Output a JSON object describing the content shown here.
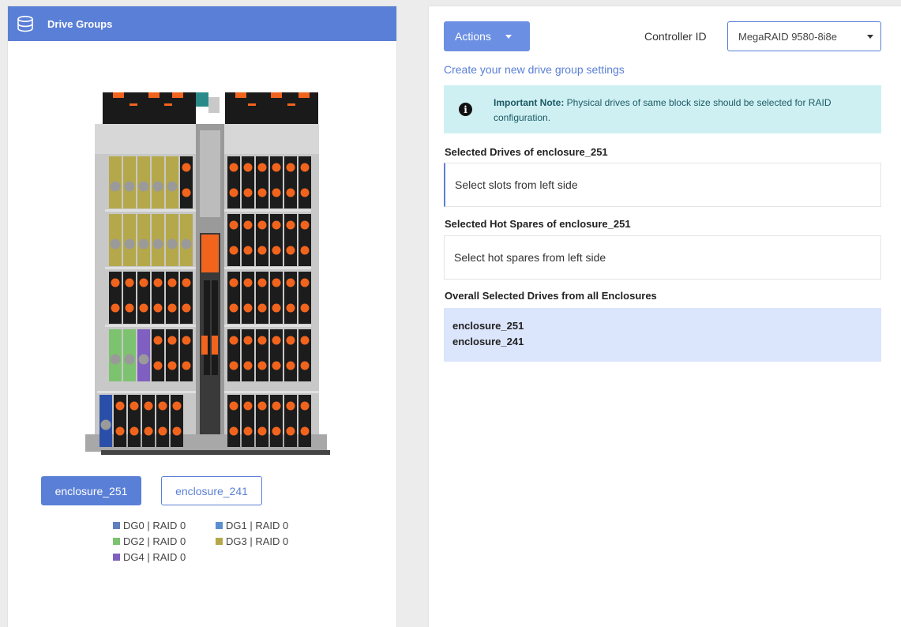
{
  "left_panel": {
    "title": "Drive Groups",
    "enclosure_buttons": [
      {
        "label": "enclosure_251",
        "active": true
      },
      {
        "label": "enclosure_241",
        "active": false
      }
    ],
    "legend": [
      {
        "label": "DG0 | RAID 0",
        "color": "#5f7fbf"
      },
      {
        "label": "DG1 | RAID 0",
        "color": "#5a8ed0"
      },
      {
        "label": "DG2 | RAID 0",
        "color": "#7dc26f"
      },
      {
        "label": "DG3 | RAID 0",
        "color": "#b5a84a"
      },
      {
        "label": "DG4 | RAID 0",
        "color": "#7f5fbf"
      }
    ]
  },
  "right_panel": {
    "actions_label": "Actions",
    "controller_label": "Controller ID",
    "controller_value": "MegaRAID 9580-8i8e",
    "create_link": "Create your new drive group settings",
    "note": {
      "strong": "Important Note:",
      "text": " Physical drives of same block size should be selected for RAID configuration."
    },
    "selected_drives_title": "Selected Drives of enclosure_251",
    "selected_drives_placeholder": "Select slots from left side",
    "hot_spares_title": "Selected Hot Spares of enclosure_251",
    "hot_spares_placeholder": "Select hot spares from left side",
    "overall_title": "Overall Selected Drives from all Enclosures",
    "overall_items": [
      "enclosure_251",
      "enclosure_241"
    ]
  },
  "colors": {
    "accent": "#5a7fd6",
    "drive_orange": "#f0641e",
    "dg_olive": "#b5a84a",
    "dg_green": "#7dc26f",
    "dg_purple": "#7f5fbf",
    "dg_blue": "#2a4fa8"
  }
}
